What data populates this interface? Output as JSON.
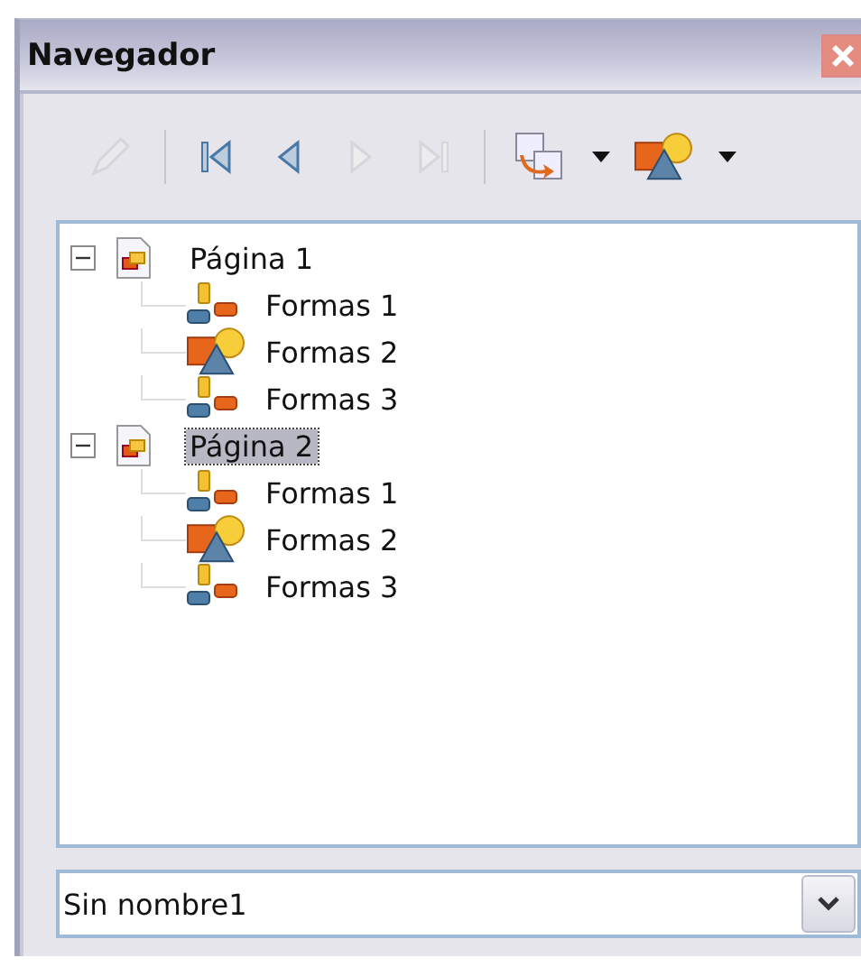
{
  "window": {
    "title": "Navegador"
  },
  "toolbar": [
    {
      "kind": "edit",
      "disabled": true
    },
    {
      "kind": "separator"
    },
    {
      "kind": "first",
      "disabled": false
    },
    {
      "kind": "previous",
      "disabled": false
    },
    {
      "kind": "next",
      "disabled": true
    },
    {
      "kind": "last",
      "disabled": true
    },
    {
      "kind": "separator"
    },
    {
      "kind": "drag-mode",
      "disabled": false
    },
    {
      "kind": "dropdown",
      "disabled": false
    },
    {
      "kind": "shapes",
      "disabled": false
    },
    {
      "kind": "dropdown",
      "disabled": false
    }
  ],
  "tree": [
    {
      "label": "Página 1",
      "expanded": true,
      "selected": false,
      "children": [
        {
          "label": "Formas 1",
          "kind": "group",
          "selected": false
        },
        {
          "label": "Formas 2",
          "kind": "shapes",
          "selected": false
        },
        {
          "label": "Formas 3",
          "kind": "group",
          "selected": false
        }
      ]
    },
    {
      "label": "Página 2",
      "expanded": true,
      "selected": true,
      "children": [
        {
          "label": "Formas 1",
          "kind": "group",
          "selected": false
        },
        {
          "label": "Formas 2",
          "kind": "shapes",
          "selected": false
        },
        {
          "label": "Formas 3",
          "kind": "group",
          "selected": false
        }
      ]
    }
  ],
  "document_select": {
    "value": "Sin nombre1"
  }
}
